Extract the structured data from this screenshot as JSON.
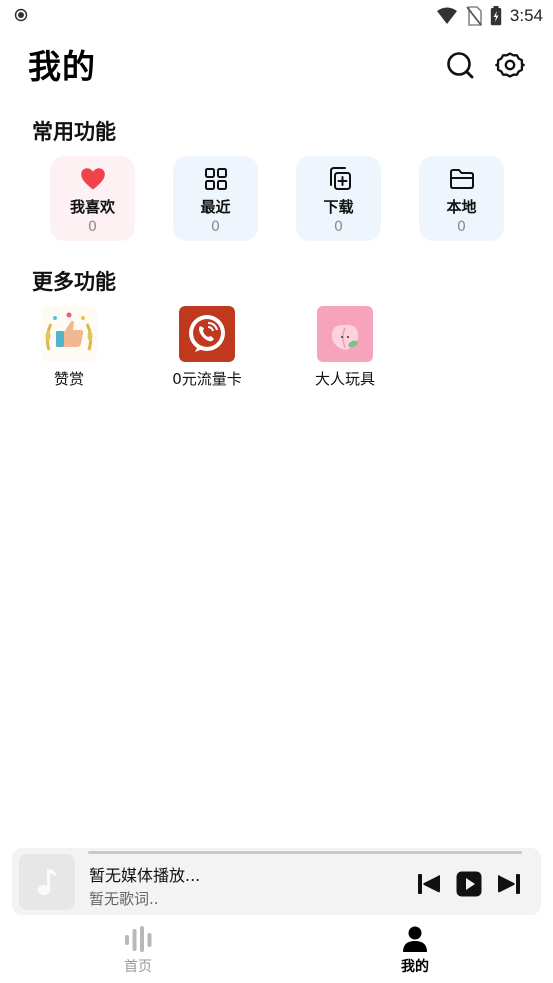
{
  "status_bar": {
    "time": "3:54"
  },
  "header": {
    "title": "我的"
  },
  "common": {
    "title": "常用功能",
    "items": [
      {
        "label": "我喜欢",
        "count": "0",
        "icon": "heart-icon",
        "bg": "#fdf1f3"
      },
      {
        "label": "最近",
        "count": "0",
        "icon": "grid-icon",
        "bg": "#eef5fd"
      },
      {
        "label": "下载",
        "count": "0",
        "icon": "download-icon",
        "bg": "#eef5fd"
      },
      {
        "label": "本地",
        "count": "0",
        "icon": "folder-icon",
        "bg": "#eef5fd"
      }
    ]
  },
  "more": {
    "title": "更多功能",
    "items": [
      {
        "label": "赞赏",
        "icon": "thumbs-up-icon"
      },
      {
        "label": "0元流量卡",
        "icon": "phone-card-icon"
      },
      {
        "label": "大人玩具",
        "icon": "peach-icon"
      }
    ]
  },
  "player": {
    "title": "暂无媒体播放...",
    "lyric": "暂无歌词.."
  },
  "tabs": [
    {
      "label": "首页",
      "icon": "waveform-icon",
      "active": false
    },
    {
      "label": "我的",
      "icon": "user-icon",
      "active": true
    }
  ],
  "colors": {
    "heart": "#f0434b",
    "card_pink": "#fdf1f3",
    "card_blue": "#eef5fd",
    "inactive_tab": "#9a9a9a"
  }
}
